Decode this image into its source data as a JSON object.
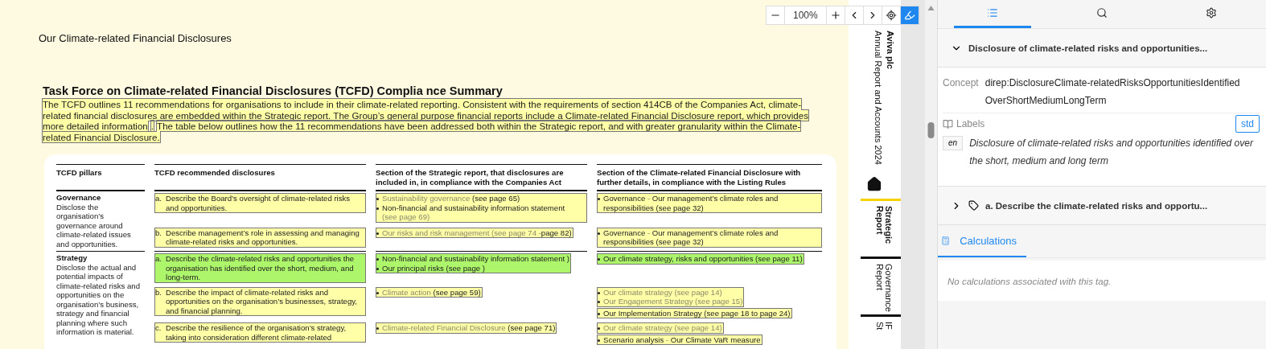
{
  "toolbar": {
    "zoom": "100%",
    "highlight_on": true
  },
  "document": {
    "section_title": "Our Climate-related Financial Disclosures",
    "heading": "Task Force on Climate-related Financial Disclosures (TCFD) Complia nce Summary",
    "intro": [
      "The TCFD outlines 11 recommendations for organisations to include in their climate-related reporting. Consistent with the requirements of section 414CB of the Companies Act, climate-related financial disclosures are embedded within the Strategic report. The Group’s general purpose financial reports include a Climate-related Financial Disclosure report, which provides more detailed information",
      ".",
      "The table below outlines how the 11 recommendations have been addressed both within the Strategic report, and with greater granularity within the Climate-related Financial Disclosure."
    ],
    "table": {
      "columns": [
        "TCFD pillars",
        "TCFD recommended disclosures",
        "Section of the Strategic report, that disclosures are included in, in compliance with the Companies Act",
        "Section of the Climate-related Financial Disclosure with further details, in compliance with the Listing Rules"
      ],
      "groups": [
        {
          "pillar": {
            "name": "Governance",
            "description": "Disclose the organisation’s governance around climate-related issues and opportunities."
          },
          "rows": [
            {
              "disclosure": {
                "marker": "a.",
                "text": "Describe the Board’s oversight of climate-related risks and opportunities.",
                "selected": false
              },
              "strategic_report": {
                "blocks": [
                  {
                    "selected": false,
                    "items": [
                      {
                        "parts": [
                          {
                            "text": "Sustainability governance",
                            "link": true
                          },
                          {
                            "text": " (see page 65)",
                            "link": false
                          }
                        ]
                      },
                      {
                        "parts": [
                          {
                            "text": "Non-financial and sustainability information statement ",
                            "link": false
                          },
                          {
                            "text": "(see page 69)",
                            "link": true
                          }
                        ]
                      }
                    ]
                  }
                ]
              },
              "cfd": {
                "blocks": [
                  {
                    "selected": false,
                    "items": [
                      {
                        "parts": [
                          {
                            "text": "Governance",
                            "link": false
                          },
                          {
                            "text": " - ",
                            "link": true
                          },
                          {
                            "text": "Our management’s climate roles and responsibilities (see page 32)",
                            "link": false
                          }
                        ]
                      }
                    ]
                  }
                ]
              }
            },
            {
              "disclosure": {
                "marker": "b.",
                "text": "Describe management’s role in assessing and managing climate-related risks and opportunities.",
                "selected": false
              },
              "strategic_report": {
                "blocks": [
                  {
                    "selected": false,
                    "items": [
                      {
                        "parts": [
                          {
                            "text": "Our risks and risk management (see page 74 -",
                            "link": true
                          },
                          {
                            "text": "page 82)",
                            "link": false
                          }
                        ]
                      }
                    ]
                  }
                ]
              },
              "cfd": {
                "blocks": [
                  {
                    "selected": false,
                    "items": [
                      {
                        "parts": [
                          {
                            "text": "Governance",
                            "link": false
                          },
                          {
                            "text": " - ",
                            "link": true
                          },
                          {
                            "text": "Our management’s climate roles and responsibilities (see page 32)",
                            "link": false
                          }
                        ]
                      }
                    ]
                  }
                ]
              }
            }
          ]
        },
        {
          "pillar": {
            "name": "Strategy",
            "description": "Disclose the actual and potential impacts of climate-related risks and opportunities on the organisation’s business, strategy and financial planning where such information is material."
          },
          "rows": [
            {
              "disclosure": {
                "marker": "a.",
                "text": "Describe the climate-related risks and opportunities the organisation has identified over the short, medium, and long-term.",
                "selected": true
              },
              "strategic_report": {
                "blocks": [
                  {
                    "selected": true,
                    "items": [
                      {
                        "parts": [
                          {
                            "text": "Non-financial and sustainability information statement )",
                            "link": false
                          }
                        ]
                      },
                      {
                        "parts": [
                          {
                            "text": "Our principal risks (see page )",
                            "link": false
                          }
                        ]
                      }
                    ]
                  }
                ]
              },
              "cfd": {
                "blocks": [
                  {
                    "selected": true,
                    "items": [
                      {
                        "parts": [
                          {
                            "text": "Our climate strategy, risks and opportunities (see page 11)",
                            "link": false
                          }
                        ]
                      }
                    ]
                  }
                ]
              }
            },
            {
              "disclosure": {
                "marker": "b.",
                "text": "Describe the impact of climate-related risks and opportunities on the organisation’s businesses, strategy, and financial planning.",
                "selected": false
              },
              "strategic_report": {
                "blocks": [
                  {
                    "selected": false,
                    "items": [
                      {
                        "parts": [
                          {
                            "text": "Climate action",
                            "link": true
                          },
                          {
                            "text": " (see page 59)",
                            "link": false
                          }
                        ]
                      }
                    ]
                  }
                ]
              },
              "cfd": {
                "blocks": [
                  {
                    "selected": false,
                    "items": [
                      {
                        "parts": [
                          {
                            "text": "Our climate strategy (see page 14)",
                            "link": true
                          }
                        ]
                      },
                      {
                        "parts": [
                          {
                            "text": "Our Engagement Strategy (see page 15)",
                            "link": true
                          }
                        ]
                      }
                    ]
                  },
                  {
                    "selected": false,
                    "items": [
                      {
                        "parts": [
                          {
                            "text": "Our Implementation Strategy (see page 18 to page 24)",
                            "link": false
                          }
                        ]
                      }
                    ]
                  }
                ]
              }
            },
            {
              "disclosure": {
                "marker": "c.",
                "text": "Describe the resilience of the organisation’s strategy, taking into consideration different climate-related",
                "selected": false
              },
              "strategic_report": {
                "blocks": [
                  {
                    "selected": false,
                    "items": [
                      {
                        "parts": [
                          {
                            "text": "Climate-related Financial Disclosure",
                            "link": true
                          },
                          {
                            "text": " (see page 71)",
                            "link": false
                          }
                        ]
                      }
                    ]
                  }
                ]
              },
              "cfd": {
                "blocks": [
                  {
                    "selected": false,
                    "items": [
                      {
                        "parts": [
                          {
                            "text": "Our climate strategy (see page 14)",
                            "link": true
                          }
                        ]
                      }
                    ]
                  },
                  {
                    "selected": false,
                    "items": [
                      {
                        "parts": [
                          {
                            "text": "Scenario analysis",
                            "link": false
                          },
                          {
                            "text": " - ",
                            "link": true
                          },
                          {
                            "text": "Our Climate VaR measure",
                            "link": false
                          }
                        ]
                      }
                    ]
                  }
                ]
              }
            }
          ]
        }
      ]
    }
  },
  "side_nav": {
    "company": "Aviva plc",
    "report": "Annual Report and Accounts 2024",
    "items": [
      {
        "label": "Strategic Report",
        "selected": true
      },
      {
        "label": "Governance Report",
        "selected": false
      },
      {
        "label": "IF St",
        "selected": false
      }
    ]
  },
  "inspector": {
    "tabs": [
      {
        "kind": "list",
        "selected": true
      },
      {
        "kind": "search",
        "selected": false
      },
      {
        "kind": "settings",
        "selected": false
      }
    ],
    "facts": [
      {
        "title": "Disclosure of climate-related risks and opportunities...",
        "expanded": true,
        "concept_label": "Concept",
        "concept": "direp:DisclosureClimate-relatedRisksOpportunitiesIdentifiedOverShortMediumLongTerm",
        "labels_heading": "Labels",
        "label_role": "std",
        "lang": "en",
        "label": "Disclosure of climate-related risks and opportunities identified over the short, medium and long term"
      },
      {
        "title": "a. Describe the climate-related risks and opportu...",
        "expanded": false
      }
    ],
    "calculations": {
      "tab": "Calculations",
      "selected": true,
      "message": "No calculations associated with this tag."
    }
  }
}
